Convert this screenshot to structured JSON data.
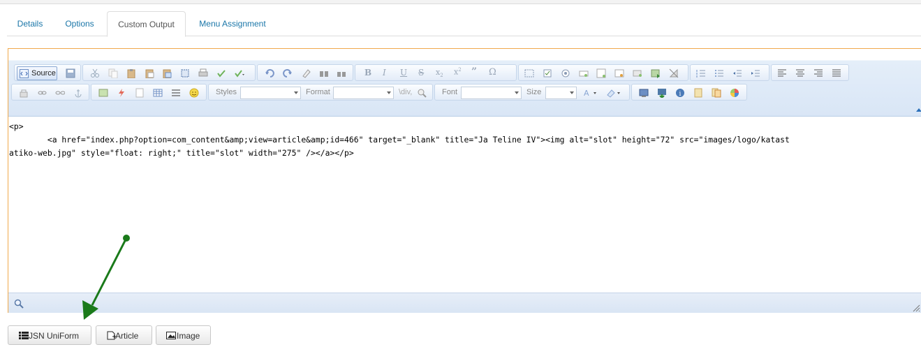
{
  "tabs": [
    {
      "label": "Details"
    },
    {
      "label": "Options"
    },
    {
      "label": "Custom Output",
      "active": true
    },
    {
      "label": "Menu Assignment"
    }
  ],
  "toolbar": {
    "source_label": "Source",
    "styles_label": "Styles",
    "format_label": "Format",
    "font_label": "Font",
    "size_label": "Size",
    "div_label": "\\div,"
  },
  "editor": {
    "line1": "<p>",
    "line2": "        <a href=\"index.php?option=com_content&amp;view=article&amp;id=466\" target=\"_blank\" title=\"Ja Teline IV\"><img alt=\"slot\" height=\"72\" src=\"images/logo/katast",
    "line3": "atiko-web.jpg\" style=\"float: right;\" title=\"slot\" width=\"275\" /></a></p>"
  },
  "buttons": [
    {
      "label": "JSN UniForm",
      "icon": "list-icon"
    },
    {
      "label": "Article",
      "icon": "article-icon"
    },
    {
      "label": "Image",
      "icon": "image-icon"
    }
  ],
  "colors": {
    "tab_link": "#1a76a8",
    "editor_border": "#f0a94c",
    "annotation_arrow": "#1a7a1a"
  }
}
